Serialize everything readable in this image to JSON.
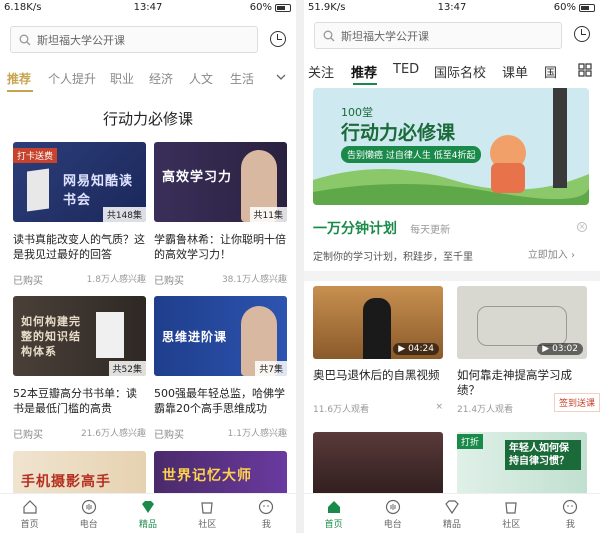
{
  "left": {
    "status": {
      "speed": "6.18K/s",
      "time": "13:47",
      "battery": "60%"
    },
    "search_placeholder": "斯坦福大学公开课",
    "tabs": [
      "推荐",
      "个人提升",
      "职业",
      "经济",
      "人文",
      "生活"
    ],
    "section_title": "行动力必修课",
    "cards": [
      {
        "tag": "打卡送费",
        "cover_text": "网易知酷读书会",
        "count": "共148集",
        "title": "读书真能改变人的气质？这是我见过最好的回答",
        "bought": "已购买",
        "stat": "1.8万人感兴趣"
      },
      {
        "tag": "",
        "cover_text": "高效学习力",
        "count": "共11集",
        "title": "学霸鲁林希：让你聪明十倍的高效学习力！",
        "bought": "已购买",
        "stat": "38.1万人感兴趣"
      },
      {
        "tag": "",
        "cover_text": "如何构建完整的知识结构体系",
        "count": "共52集",
        "title": "52本豆瓣高分书书单：读书是最低门槛的高贵",
        "bought": "已购买",
        "stat": "21.6万人感兴趣"
      },
      {
        "tag": "",
        "cover_text": "思维进阶课",
        "count": "共7集",
        "title": "500强最年轻总监，哈佛学霸靠20个高手思维成功",
        "bought": "已购买",
        "stat": "1.1万人感兴趣"
      },
      {
        "tag": "",
        "cover_text": "手机摄影高手",
        "count": "",
        "title": "",
        "bought": "",
        "stat": ""
      },
      {
        "tag": "",
        "cover_text": "世界记忆大师",
        "count": "",
        "title": "",
        "bought": "",
        "stat": ""
      }
    ],
    "nav": [
      "首页",
      "电台",
      "精品",
      "社区",
      "我"
    ]
  },
  "right": {
    "status": {
      "speed": "51.9K/s",
      "time": "13:47",
      "battery": "60%"
    },
    "search_placeholder": "斯坦福大学公开课",
    "tabs": [
      "关注",
      "推荐",
      "TED",
      "国际名校",
      "课单",
      "国"
    ],
    "banner": {
      "small": "100堂",
      "title": "行动力必修课",
      "sub": "告别懒癌 过自律人生 低至4折起"
    },
    "plan": {
      "title": "一万分钟计划",
      "sub": "每天更新",
      "desc": "定制你的学习计划，积跬步，至千里",
      "action": "立即加入 ›"
    },
    "videos": [
      {
        "duration": "04:24",
        "title": "奥巴马退休后的自黑视频",
        "views": "11.6万人观看"
      },
      {
        "duration": "03:02",
        "title": "如何靠走神提高学习成绩？",
        "views": "21.4万人观看"
      },
      {
        "duration": "",
        "title": "",
        "views": ""
      },
      {
        "duration": "",
        "title": "年轻人如何保持自律习惯？",
        "views": ""
      }
    ],
    "tag_daka": "打折",
    "sign": "签到送课",
    "nav": [
      "首页",
      "电台",
      "精品",
      "社区",
      "我"
    ]
  }
}
